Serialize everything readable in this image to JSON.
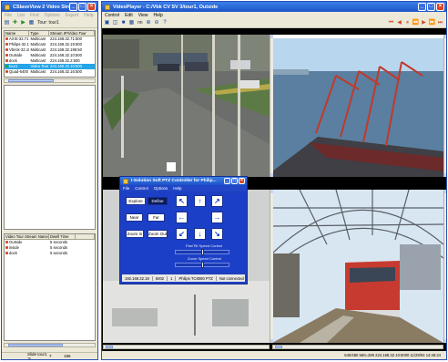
{
  "left_window": {
    "title": "CSlaveView 2 Video Strea...",
    "menu": [
      "File",
      "List",
      "Find",
      "Options",
      "Export",
      "Help"
    ],
    "toolbar": {
      "tour_label": "Tour: tour1"
    },
    "streams_header": [
      "Name",
      "Type",
      "Stream IP/Video Tour"
    ],
    "streams": [
      {
        "name": "AXIS-32.71",
        "type": "Multicast",
        "ip": "224.168.32.71:500",
        "status": "red",
        "selected": false
      },
      {
        "name": "Philips-32.19",
        "type": "Multicast",
        "ip": "224.168.32.19:500",
        "status": "red",
        "selected": false
      },
      {
        "name": "Vbrick-32.195",
        "type": "Multicast",
        "ip": "224.168.32.195:50",
        "status": "red",
        "selected": false
      },
      {
        "name": "Outside",
        "type": "Multicast",
        "ip": "224.168.32.10:500",
        "status": "red",
        "selected": false
      },
      {
        "name": "dock",
        "type": "Multicast",
        "ip": "224.168.32.2:500",
        "status": "red",
        "selected": false
      },
      {
        "name": "tour1",
        "type": "Video Tour",
        "ip": "224.168.32.10:500",
        "status": "green",
        "selected": true
      },
      {
        "name": "Quad-6400",
        "type": "Multicast",
        "ip": "224.168.32.16:500",
        "status": "red",
        "selected": false
      }
    ],
    "tour_header": [
      "Video Tour Stream Name",
      "Dwell Time",
      ""
    ],
    "tour_items": [
      {
        "name": "Outside",
        "dwell": "5 seconds"
      },
      {
        "name": "inside",
        "dwell": "5 seconds"
      },
      {
        "name": "dock",
        "dwell": "5 seconds"
      }
    ],
    "status": {
      "slide": "Slide tour1 :5",
      "a": "7",
      "b": "196"
    }
  },
  "main_window": {
    "title": "VideoPlayer - C:/Vbk CV SV 3/tour1, Outside",
    "menu": [
      "Control",
      "Edit",
      "View",
      "Help"
    ],
    "toolbar_zoom_label": "nn",
    "status_right": "640/480  560=299  224.168.32.10:5000  11/29/04 14:46:24"
  },
  "ptz_dialog": {
    "title": "I-Solution Soft PTZ Controller for Philip...",
    "menu": [
      "File",
      "Control",
      "Options",
      "Help"
    ],
    "buttons": {
      "explore": "Explore",
      "define": "Define",
      "near": "Near",
      "far": "Far",
      "zoom_in": "Zoom In",
      "zoom_out": "Zoom Out"
    },
    "pan_tilt_label": "Pan/Tilt Speed Control",
    "pan_tilt_level": 0.5,
    "zoom_speed_label": "Zoom Speed Control",
    "zoom_speed_level": 0.5,
    "status": [
      "192.168.32.18",
      "6002",
      "1",
      "Philips TC8080 PTZ",
      "Not connected"
    ]
  },
  "colors": {
    "titlebar": "#1c54c9",
    "selection": "#24a5e8",
    "ptz_bg": "#1c3fc7"
  }
}
